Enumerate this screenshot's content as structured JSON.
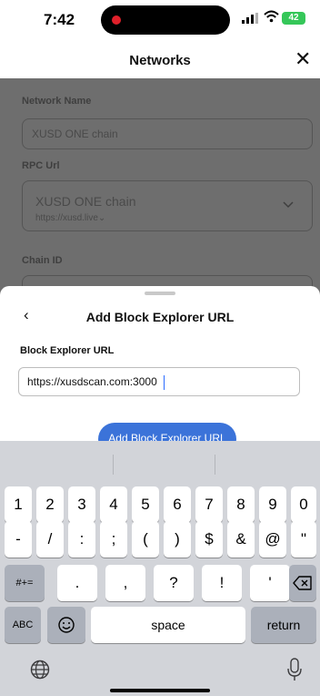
{
  "status_bar": {
    "time": "7:42",
    "battery": "42"
  },
  "header": {
    "title": "Networks",
    "close_icon": "close-icon"
  },
  "background_form": {
    "network_name_label": "Network Name",
    "network_name_value": "XUSD ONE chain",
    "rpc_label": "RPC Url",
    "rpc_name": "XUSD ONE chain",
    "rpc_url": "https://xusd.live",
    "chain_id_label": "Chain ID"
  },
  "sheet": {
    "title": "Add Block Explorer URL",
    "field_label": "Block Explorer URL",
    "field_value": "https://xusdscan.com:3000",
    "add_button": "Add Block Explorer URL"
  },
  "keyboard": {
    "row1": [
      "1",
      "2",
      "3",
      "4",
      "5",
      "6",
      "7",
      "8",
      "9",
      "0"
    ],
    "row2": [
      "-",
      "/",
      ":",
      ";",
      "(",
      ")",
      "$",
      "&",
      "@",
      "\""
    ],
    "row3_left": "#+=",
    "row3_middle": [
      ".",
      ",",
      "?",
      "!",
      "'"
    ],
    "abc": "ABC",
    "space": "space",
    "return": "return"
  }
}
